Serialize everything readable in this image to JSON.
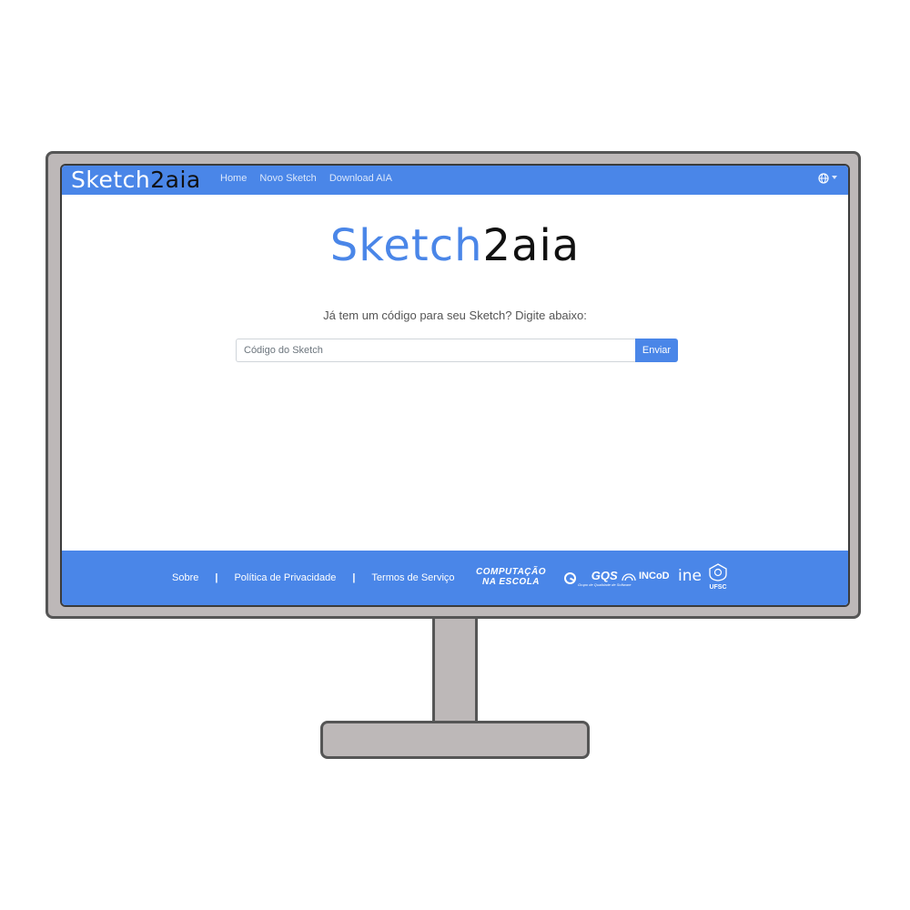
{
  "navbar": {
    "brand_part1": "Sketch",
    "brand_part2": "2aia",
    "links": [
      "Home",
      "Novo Sketch",
      "Download AIA"
    ],
    "language_icon": "globe-icon"
  },
  "main": {
    "logo_part1": "Sketch",
    "logo_part2": "2aia",
    "prompt": "Já tem um código para seu Sketch? Digite abaixo:",
    "input_placeholder": "Código do Sketch",
    "input_value": "",
    "submit_label": "Enviar"
  },
  "footer": {
    "links": [
      "Sobre",
      "Política de Privacidade",
      "Termos de Serviço"
    ],
    "separator": "|",
    "partners": {
      "computacao_line1": "COMPUTAÇÃO",
      "computacao_line2": "NA ESCOLA",
      "gqs": "GQS",
      "gqs_sub": "Grupo de Qualidade de Software",
      "incod": "INCoD",
      "ine": "ine",
      "ufsc": "UFSC"
    }
  },
  "colors": {
    "accent": "#4a86e8",
    "brand_dark": "#111111",
    "monitor_frame": "#bdb8b8"
  }
}
